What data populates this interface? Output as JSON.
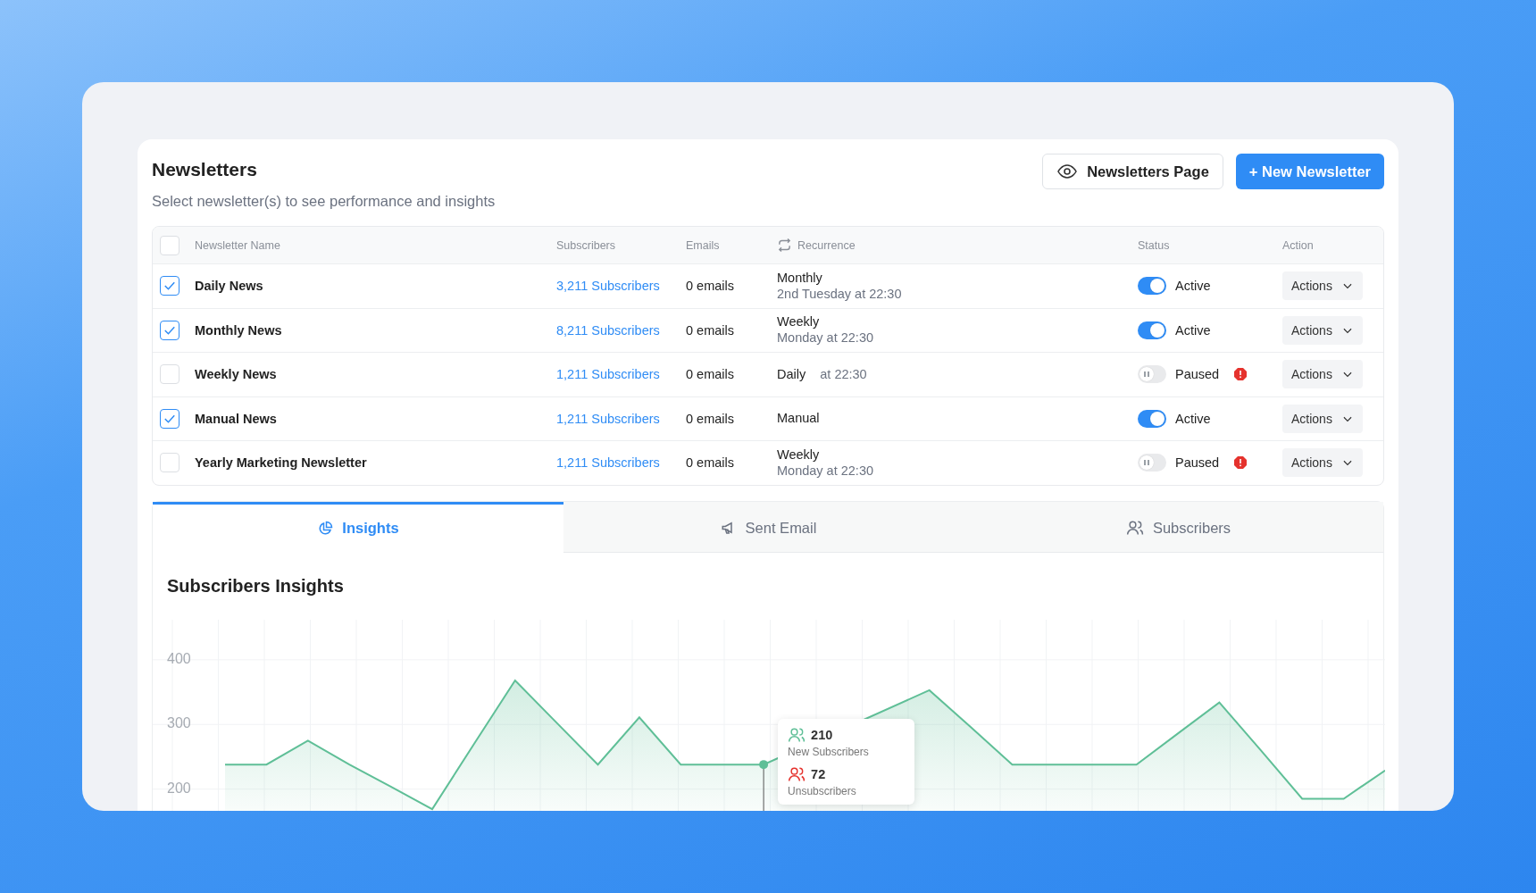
{
  "header": {
    "title": "Newsletters",
    "subtitle": "Select newsletter(s) to see performance and insights"
  },
  "buttons": [
    {
      "label": "Newsletters Page",
      "kind": "secondary"
    },
    {
      "label": "+ New Newsletter",
      "kind": "primary"
    }
  ],
  "table": {
    "select_all": {
      "checked": false
    },
    "columns": [
      "Newsletter Name",
      "Subscribers",
      "Emails",
      "Recurrence",
      "Status",
      "Action"
    ],
    "rows": [
      {
        "selected": true,
        "name": "Daily News",
        "subscribers": "3,211 Subscribers",
        "emails": "0 emails",
        "recurrence": {
          "kind": "stacked",
          "main": "Monthly",
          "detail": "2nd Tuesday at 22:30"
        },
        "status": {
          "on": true,
          "label": "Active",
          "warning": false
        },
        "action": "Actions"
      },
      {
        "selected": true,
        "name": "Monthly News",
        "subscribers": "8,211 Subscribers",
        "emails": "0 emails",
        "recurrence": {
          "kind": "stacked",
          "main": "Weekly",
          "detail": "Monday at 22:30"
        },
        "status": {
          "on": true,
          "label": "Active",
          "warning": false
        },
        "action": "Actions"
      },
      {
        "selected": false,
        "name": "Weekly News",
        "subscribers": "1,211 Subscribers",
        "emails": "0 emails",
        "recurrence": {
          "kind": "inline",
          "main": "Daily",
          "detail": "at 22:30"
        },
        "status": {
          "on": false,
          "label": "Paused",
          "warning": true
        },
        "action": "Actions"
      },
      {
        "selected": true,
        "name": "Manual News",
        "subscribers": "1,211 Subscribers",
        "emails": "0 emails",
        "recurrence": {
          "kind": "stacked",
          "main": "Manual"
        },
        "status": {
          "on": true,
          "label": "Active",
          "warning": false
        },
        "action": "Actions"
      },
      {
        "selected": false,
        "name": "Yearly Marketing Newsletter",
        "subscribers": "1,211 Subscribers",
        "emails": "0 emails",
        "recurrence": {
          "kind": "stacked",
          "main": "Weekly",
          "detail": "Monday at 22:30"
        },
        "status": {
          "on": false,
          "label": "Paused",
          "warning": true
        },
        "action": "Actions"
      }
    ]
  },
  "tabs": [
    {
      "label": "Insights",
      "selected": true
    },
    {
      "label": "Sent Email",
      "selected": false
    },
    {
      "label": "Subscribers",
      "selected": false
    }
  ],
  "insights": {
    "title": "Subscribers Insights",
    "chart_data": {
      "type": "area",
      "categories": [
        null,
        null,
        null,
        null,
        null,
        null,
        null,
        null,
        null,
        null,
        null,
        null,
        null,
        null,
        null,
        null,
        null,
        null,
        null,
        null,
        null,
        null,
        null,
        null,
        null,
        null,
        null,
        null,
        null
      ],
      "series": [
        {
          "name": "New Subscribers",
          "color": "#5fbf97",
          "values": [
            238,
            238,
            275,
            238,
            204,
            169,
            269,
            368,
            303,
            238,
            311,
            238,
            238,
            238,
            null,
            null,
            null,
            353,
            296,
            238,
            238,
            238,
            238,
            286,
            334,
            260,
            185,
            185,
            229
          ]
        }
      ],
      "ylim": [
        165,
        462
      ],
      "yticks": [
        200,
        300,
        400
      ],
      "grid": true
    },
    "tooltip": {
      "new_count": "210",
      "unsub_count": "72",
      "unsub_label": "Unsubscribers"
    }
  }
}
